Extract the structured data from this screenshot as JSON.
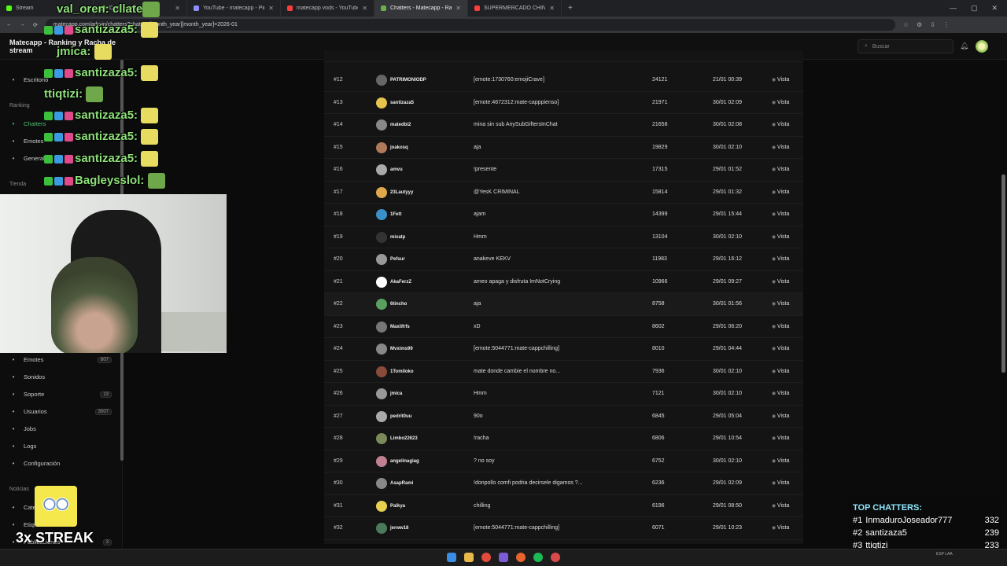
{
  "browser": {
    "tabs": [
      {
        "title": "Stream",
        "color": "#53fc18"
      },
      {
        "title": "Dashboard",
        "color": "#6ab04c"
      },
      {
        "title": "YouTube - matecapp - Pingcord",
        "color": "#8e8eff"
      },
      {
        "title": "matecapp vods - YouTube",
        "color": "#ff3d3d"
      },
      {
        "title": "Chatters - Matecapp - Ranking",
        "color": "#6ab04c"
      },
      {
        "title": "SUPERMERCADO CHINO - YouTube",
        "color": "#ff3d3d"
      }
    ],
    "url": "matecapp.com/admin/chatters?chatters[month_year][month_year]=2026-01"
  },
  "app": {
    "brand": "Matecapp - Ranking y Racha de stream",
    "search_placeholder": "Buscar"
  },
  "sidebar": {
    "items_top": [
      {
        "label": "Escritorio",
        "icon": "home-icon"
      }
    ],
    "section_ranking": "Ranking",
    "ranking_items": [
      {
        "label": "Chatters",
        "icon": "chat-icon"
      },
      {
        "label": "Emotes",
        "icon": "smile-icon"
      },
      {
        "label": "General",
        "icon": "globe-icon"
      }
    ],
    "section_tienda": "Tienda",
    "items_mid": [
      {
        "label": "Emotes",
        "badge": "807"
      },
      {
        "label": "Sonidos",
        "badge": ""
      },
      {
        "label": "Soporte",
        "badge": "13"
      },
      {
        "label": "Usuarios",
        "badge": "3007"
      },
      {
        "label": "Jobs",
        "badge": ""
      },
      {
        "label": "Logs",
        "badge": ""
      },
      {
        "label": "Configuración",
        "badge": ""
      }
    ],
    "section_noticias": "Noticias",
    "noticias_items": [
      {
        "label": "Categorías",
        "badge": ""
      },
      {
        "label": "Etiquetas",
        "badge": ""
      },
      {
        "label": "Publicaciones",
        "badge": "3"
      }
    ]
  },
  "table": {
    "view_label": "Vista",
    "rows": [
      {
        "rank": "#12",
        "user": "PATRIMONIODP",
        "msg": "[emote:1730760:emojiCrave]",
        "count": "24121",
        "date": "21/01 00:39"
      },
      {
        "rank": "#13",
        "user": "santizaza5",
        "msg": "[emote:4672312:mate-capppienso]",
        "count": "21971",
        "date": "30/01 02:09"
      },
      {
        "rank": "#14",
        "user": "matedbi2",
        "msg": "mina sin sub AnySubGiftersInChat",
        "count": "21658",
        "date": "30/01 02:08"
      },
      {
        "rank": "#15",
        "user": "joakosq",
        "msg": "aja",
        "count": "19829",
        "date": "30/01 02:10"
      },
      {
        "rank": "#16",
        "user": "amvu",
        "msg": "!presente",
        "count": "17315",
        "date": "29/01 01:52"
      },
      {
        "rank": "#17",
        "user": "23Lautyyy",
        "msg": "@YesK CRIMINAL",
        "count": "15814",
        "date": "29/01 01:32"
      },
      {
        "rank": "#18",
        "user": "1Fett",
        "msg": "ajam",
        "count": "14399",
        "date": "29/01 15:44"
      },
      {
        "rank": "#19",
        "user": "mixatp",
        "msg": "Hmm",
        "count": "13104",
        "date": "30/01 02:10"
      },
      {
        "rank": "#20",
        "user": "Pefsur",
        "msg": "anakeve KEKV",
        "count": "11983",
        "date": "29/01 16:12"
      },
      {
        "rank": "#21",
        "user": "AkaFerzZ",
        "msg": "ameo apaga y disfruta ImNotCrying",
        "count": "10966",
        "date": "29/01 09:27"
      },
      {
        "rank": "#22",
        "user": "6tincho",
        "msg": "aja",
        "count": "8758",
        "date": "30/01 01:56"
      },
      {
        "rank": "#23",
        "user": "Maxlifrfs",
        "msg": "xD",
        "count": "8602",
        "date": "29/01 06:20"
      },
      {
        "rank": "#24",
        "user": "Mvxims99",
        "msg": "[emote:5044771:mate-cappchilling]",
        "count": "8010",
        "date": "29/01 04:44"
      },
      {
        "rank": "#25",
        "user": "1Tomiloko",
        "msg": "mate donde cambie el nombre no...",
        "count": "7936",
        "date": "30/01 02:10"
      },
      {
        "rank": "#26",
        "user": "jmica",
        "msg": "Hmm",
        "count": "7121",
        "date": "30/01 02:10"
      },
      {
        "rank": "#27",
        "user": "pedrit0uu",
        "msg": "90o",
        "count": "6845",
        "date": "29/01 05:04"
      },
      {
        "rank": "#28",
        "user": "Limbo22623",
        "msg": "!racha",
        "count": "6806",
        "date": "29/01 10:54"
      },
      {
        "rank": "#29",
        "user": "angelinagiag",
        "msg": "? no soy",
        "count": "6752",
        "date": "30/01 02:10"
      },
      {
        "rank": "#30",
        "user": "AsapRami",
        "msg": "!donpollo comfi podria decirsele digamos ?...",
        "count": "6236",
        "date": "29/01 02:09"
      },
      {
        "rank": "#31",
        "user": "Palkya",
        "msg": "chilling",
        "count": "6196",
        "date": "29/01 08:50"
      },
      {
        "rank": "#32",
        "user": "jerww18",
        "msg": "[emote:5044771:mate-cappchilling]",
        "count": "6071",
        "date": "29/01 10:23"
      }
    ]
  },
  "overlay": {
    "chat": [
      {
        "name": "val_oren",
        "text": "cllate"
      },
      {
        "name": "santizaza5",
        "text": ""
      },
      {
        "name": "jmica",
        "text": ""
      },
      {
        "name": "santizaza5",
        "text": ""
      },
      {
        "name": "ttiqtizi",
        "text": ""
      },
      {
        "name": "santizaza5",
        "text": ""
      },
      {
        "name": "santizaza5",
        "text": ""
      },
      {
        "name": "santizaza5",
        "text": ""
      },
      {
        "name": "Bagleysslol",
        "text": ""
      }
    ],
    "streak": "3x STREAK",
    "top_chatters_title": "TOP CHATTERS:",
    "top_chatters": [
      {
        "rank": "#1",
        "name": "InmaduroJoseador777",
        "count": "332"
      },
      {
        "rank": "#2",
        "name": "santizaza5",
        "count": "239"
      },
      {
        "rank": "#3",
        "name": "ttiqtizi",
        "count": "233"
      }
    ]
  },
  "taskbar": {
    "lang": "ESP LAA"
  }
}
